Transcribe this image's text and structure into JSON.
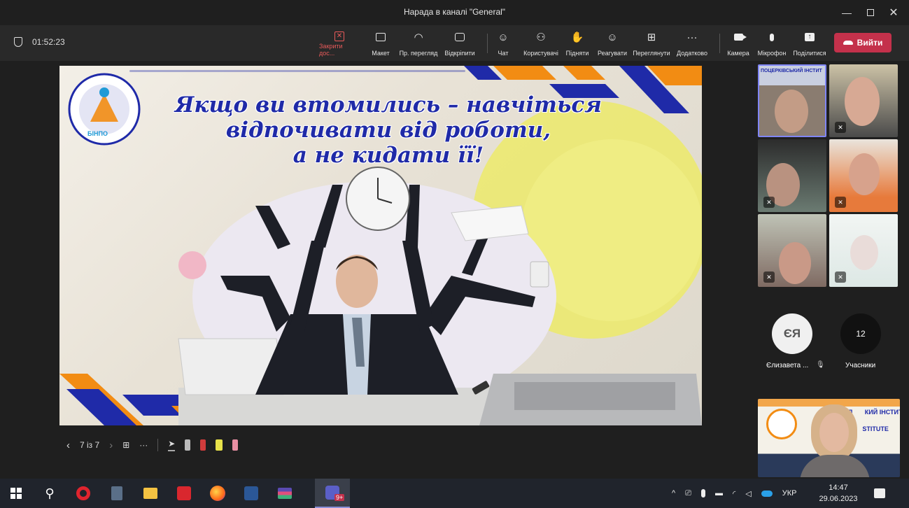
{
  "window": {
    "title": "Нарада в каналі \"General\""
  },
  "meeting": {
    "timer": "01:52:23"
  },
  "toolbar": {
    "stop_share": "Закрити дос...",
    "layout": "Макет",
    "view": "Пр. перегляд",
    "popout": "Відкріпити",
    "chat": "Чат",
    "people": "Користувачі",
    "raise": "Підняти",
    "react": "Реагувати",
    "rooms": "Переглянути",
    "more": "Додатково",
    "camera": "Камера",
    "mic": "Мікрофон",
    "share": "Поділитися",
    "leave": "Вийти"
  },
  "slide": {
    "title_line1": "Якщо ви втомились – навчіться",
    "title_line2": "відпочивати від роботи,",
    "title_line3": "а не кидати її!",
    "logo_text": "БІНПО",
    "counter": "7 із 7"
  },
  "panel": {
    "tile1_banner": "ПОЦЕРКІВСЬКИЙ ІНСТИТ",
    "participant_initials": "ЄЯ",
    "participant_name": "Єлизавета ...",
    "participant_count": "12",
    "participants_label": "Учасники",
    "presenter_banner_line1": "БІЛ       КИЙ ІНСТИТУТ",
    "presenter_banner_line2": "BIL      STITUTE"
  },
  "taskbar": {
    "lang": "УКР",
    "time": "14:47",
    "date": "29.06.2023",
    "teams_badge": "9+"
  },
  "colors": {
    "accent_red": "#c4314b",
    "slide_blue": "#1f2aa8",
    "slide_orange": "#f28c13",
    "selected_tile": "#7f85f5"
  }
}
